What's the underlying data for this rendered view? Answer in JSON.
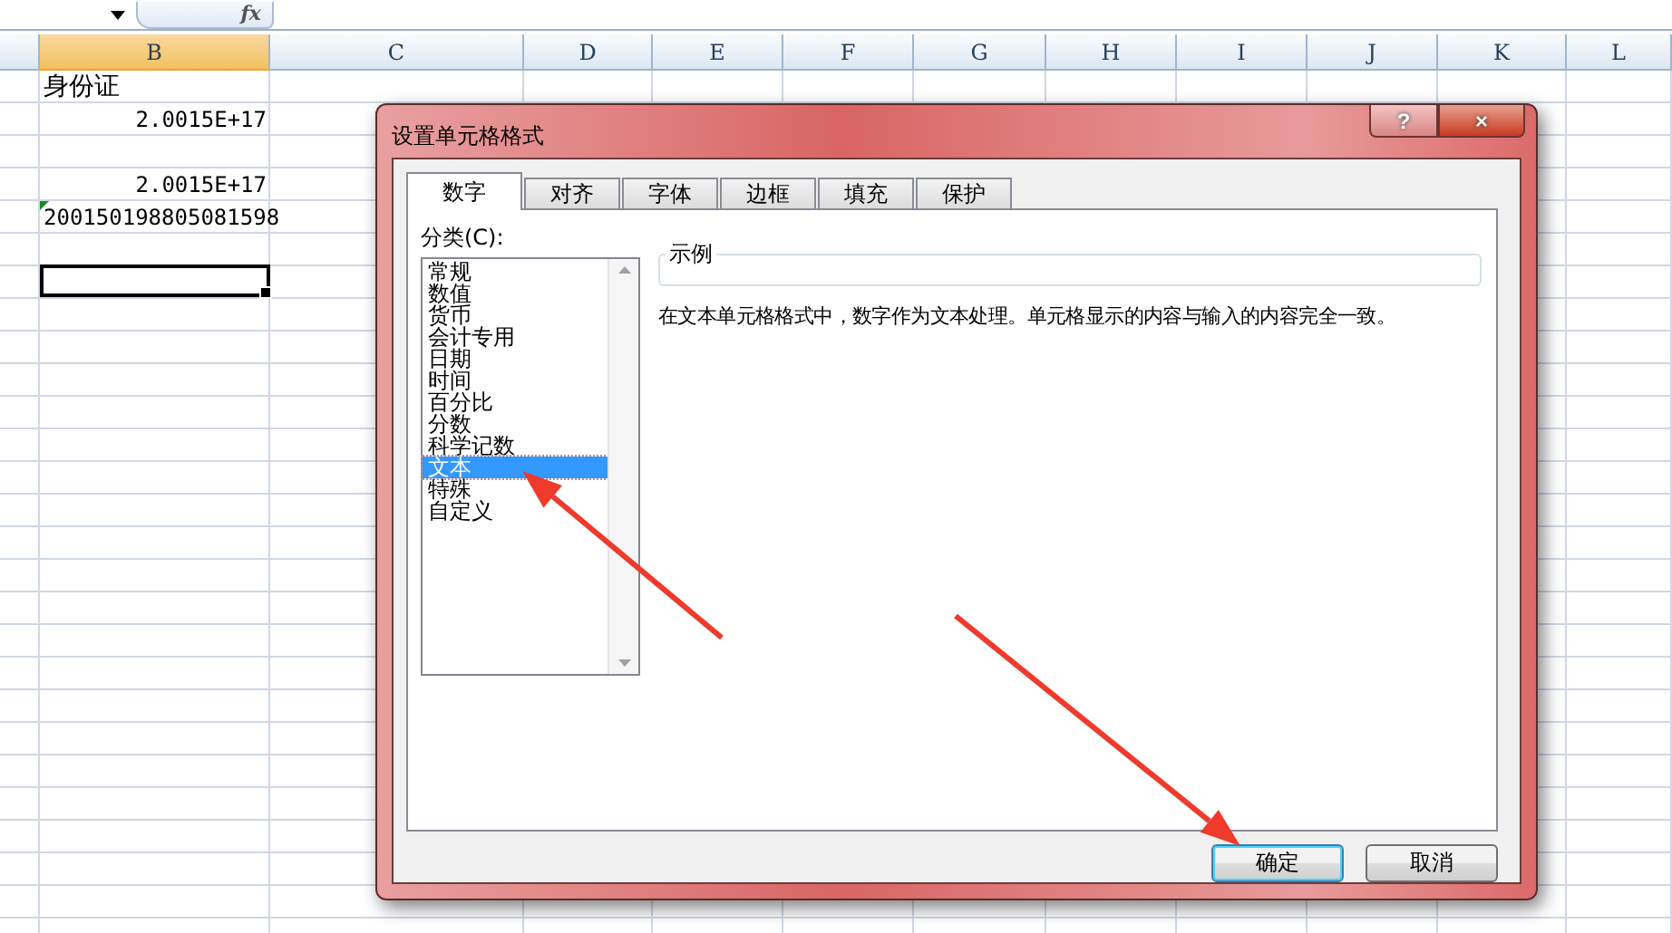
{
  "formula_bar": {
    "fx_label": "fx"
  },
  "columns": [
    {
      "label": "B",
      "selected": true
    },
    {
      "label": "C",
      "selected": false
    },
    {
      "label": "D",
      "selected": false
    },
    {
      "label": "E",
      "selected": false
    },
    {
      "label": "F",
      "selected": false
    },
    {
      "label": "G",
      "selected": false
    },
    {
      "label": "H",
      "selected": false
    },
    {
      "label": "I",
      "selected": false
    },
    {
      "label": "J",
      "selected": false
    },
    {
      "label": "K",
      "selected": false
    },
    {
      "label": "L",
      "selected": false
    }
  ],
  "cells": [
    {
      "text": "身份证",
      "kind": "text",
      "error_flag": false
    },
    {
      "text": "2.0015E+17",
      "kind": "number",
      "error_flag": false
    },
    {
      "text": "2.0015E+17",
      "kind": "number",
      "error_flag": false
    },
    {
      "text": "200150198805081598",
      "kind": "text",
      "error_flag": true
    }
  ],
  "cell_cursor": true,
  "dialog": {
    "title": "设置单元格格式",
    "help": "?",
    "close": "×",
    "tabs": [
      {
        "label": "数字",
        "selected": true
      },
      {
        "label": "对齐",
        "selected": false
      },
      {
        "label": "字体",
        "selected": false
      },
      {
        "label": "边框",
        "selected": false
      },
      {
        "label": "填充",
        "selected": false
      },
      {
        "label": "保护",
        "selected": false
      }
    ],
    "category_label": "分类(C):",
    "categories": [
      {
        "label": "常规",
        "selected": false
      },
      {
        "label": "数值",
        "selected": false
      },
      {
        "label": "货币",
        "selected": false
      },
      {
        "label": "会计专用",
        "selected": false
      },
      {
        "label": "日期",
        "selected": false
      },
      {
        "label": "时间",
        "selected": false
      },
      {
        "label": "百分比",
        "selected": false
      },
      {
        "label": "分数",
        "selected": false
      },
      {
        "label": "科学记数",
        "selected": false
      },
      {
        "label": "文本",
        "selected": true
      },
      {
        "label": "特殊",
        "selected": false
      },
      {
        "label": "自定义",
        "selected": false
      }
    ],
    "sample_label": "示例",
    "description": "在文本单元格格式中，数字作为文本处理。单元格显示的内容与输入的内容完全一致。",
    "buttons": [
      {
        "label": "确定",
        "default": true
      },
      {
        "label": "取消",
        "default": false
      }
    ]
  }
}
